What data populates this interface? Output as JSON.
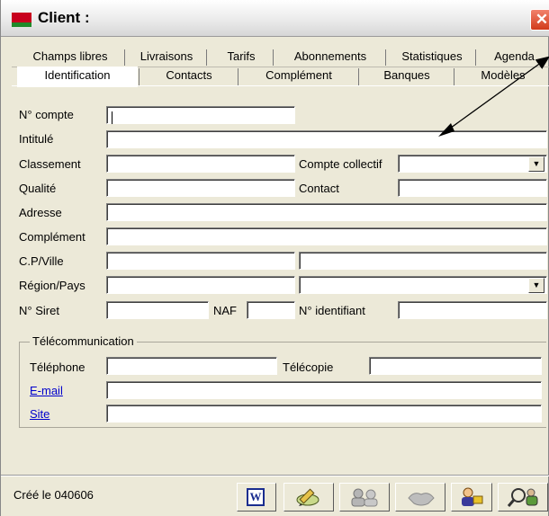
{
  "window": {
    "title": "Client :",
    "close_glyph": "✕"
  },
  "tabs": {
    "top_row": [
      "Champs libres",
      "Livraisons",
      "Tarifs",
      "Abonnements",
      "Statistiques",
      "Agenda"
    ],
    "bottom_row": [
      "Identification",
      "Contacts",
      "Complément",
      "Banques",
      "Modèles"
    ],
    "selected": "Identification"
  },
  "form": {
    "n_compte": {
      "label": "N° compte",
      "value": ""
    },
    "intitule": {
      "label": "Intitulé",
      "value": ""
    },
    "classement": {
      "label": "Classement",
      "value": ""
    },
    "compte_collectif": {
      "label": "Compte collectif",
      "value": ""
    },
    "qualite": {
      "label": "Qualité",
      "value": ""
    },
    "contact": {
      "label": "Contact",
      "value": ""
    },
    "adresse": {
      "label": "Adresse",
      "value": ""
    },
    "complement": {
      "label": "Complément",
      "value": ""
    },
    "cp_ville": {
      "label": "C.P/Ville",
      "cp": "",
      "ville": ""
    },
    "region_pays": {
      "label": "Région/Pays",
      "region": "",
      "pays": ""
    },
    "n_siret": {
      "label": "N° Siret",
      "value": ""
    },
    "naf": {
      "label": "NAF",
      "value": ""
    },
    "n_identifiant": {
      "label": "N° identifiant",
      "value": ""
    }
  },
  "telecom": {
    "legend": "Télécommunication",
    "telephone": {
      "label": "Téléphone",
      "value": ""
    },
    "telecopie": {
      "label": "Télécopie",
      "value": ""
    },
    "email": {
      "label": "E-mail",
      "value": ""
    },
    "site": {
      "label": "Site",
      "value": ""
    }
  },
  "status": {
    "created": "Créé le 040606"
  },
  "toolbar": {
    "word_glyph": "W",
    "buttons": [
      "word-icon",
      "edit-pencil-icon",
      "contacts-icon",
      "handshake-icon",
      "user-key-icon",
      "search-users-icon"
    ]
  },
  "colors": {
    "window_bg": "#ece9d8",
    "close_red": "#d13a1b",
    "link_blue": "#0000cc"
  }
}
